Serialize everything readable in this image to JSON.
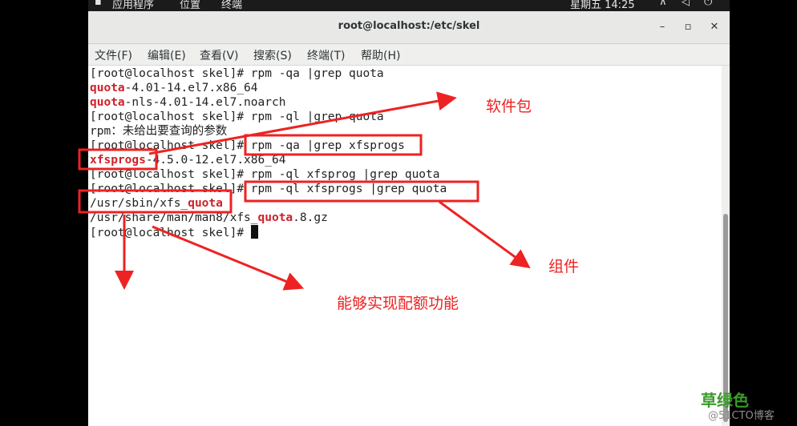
{
  "topbar": {
    "apps": "应用程序",
    "places": "位置",
    "terminal": "终端",
    "clock": "星期五 14:25"
  },
  "window": {
    "title": "root@localhost:/etc/skel",
    "minimize": "–",
    "maximize": "▫",
    "close": "✕"
  },
  "menu": {
    "file": "文件(F)",
    "edit": "编辑(E)",
    "view": "查看(V)",
    "search": "搜索(S)",
    "terminal": "终端(T)",
    "help": "帮助(H)"
  },
  "terminal": {
    "l1": "[root@localhost skel]# rpm -qa |grep quota",
    "l2_red": "quota",
    "l2_rest": "-4.01-14.el7.x86_64",
    "l3_red": "quota",
    "l3_rest": "-nls-4.01-14.el7.noarch",
    "l4": "[root@localhost skel]# rpm -ql |grep quota",
    "l5": "rpm：未给出要查询的参数",
    "l6": "[root@localhost skel]# rpm -qa |grep xfsprogs",
    "l7_red": "xfsprogs",
    "l7_rest": "-4.5.0-12.el7.x86_64",
    "l8": "[root@localhost skel]# rpm -ql xfsprog |grep quota",
    "l9": "[root@localhost skel]# rpm -ql xfsprogs |grep quota",
    "l10_pre": "/usr/sbin/xfs_",
    "l10_red": "quota",
    "l11_pre": "/usr/share/man/man8/xfs_",
    "l11_red": "quota",
    "l11_post": ".8.gz",
    "l12": "[root@localhost skel]# "
  },
  "annotations": {
    "package": "软件包",
    "component": "组件",
    "quota_function": "能够实现配额功能",
    "color": "#ee2222"
  },
  "watermark": {
    "brand": "草绿色",
    "site": "@51CTO博客"
  }
}
